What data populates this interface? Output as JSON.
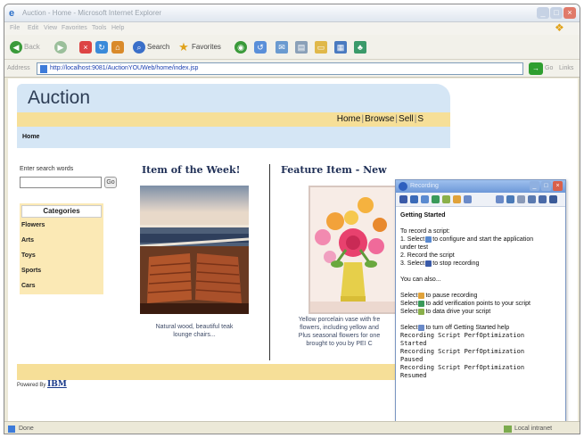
{
  "window": {
    "title": "Auction - Home - Microsoft Internet Explorer"
  },
  "menu": [
    "File",
    "Edit",
    "View",
    "Favorites",
    "Tools",
    "Help"
  ],
  "toolbar": {
    "back": "Back",
    "search": "Search",
    "favorites": "Favorites"
  },
  "address": {
    "label": "Address",
    "url": "http://localhost:9081/AuctionYOUWeb/home/index.jsp",
    "go": "Go",
    "links": "Links"
  },
  "page": {
    "site_title": "Auction",
    "nav": [
      "Home",
      "Browse",
      "Sell",
      "S"
    ],
    "home_label": "Home",
    "search_label": "Enter search words",
    "search_button": "Go",
    "categories_header": "Categories",
    "categories": [
      "Flowers",
      "Arts",
      "Toys",
      "Sports",
      "Cars"
    ],
    "item_of_week_title": "Item of the Week!",
    "item_of_week_caption_1": "Natural wood, beautiful teak",
    "item_of_week_caption_2": "lounge chairs...",
    "feature_title": "Feature Item - New",
    "feature_caption_1": "Yellow porcelain vase with fre",
    "feature_caption_2": "flowers, including yellow and",
    "feature_caption_3": "Plus seasonal flowers for one",
    "feature_caption_4": "brought to you by PEI C",
    "powered_by": "Powered By",
    "ibm": "IBM"
  },
  "status": {
    "done": "Done",
    "zone": "Local intranet"
  },
  "recorder": {
    "title": "Recording",
    "heading": "Getting Started",
    "intro": "To record a script:",
    "step1a": "1. Select",
    "step1b": "to configure and start the application",
    "step1c": "under test",
    "step2": "2. Record the script",
    "step3a": "3. Select",
    "step3b": "to stop recording",
    "also": "You can also...",
    "pause_a": "Select",
    "pause_b": "to pause recording",
    "vp_a": "Select",
    "vp_b": "to add verification points to your script",
    "dd_a": "Select",
    "dd_b": "to data drive your script",
    "off_a": "Select",
    "off_b": "to turn off Getting Started help",
    "log": [
      "Recording Script PerfOptimization",
      "Started",
      "Recording Script PerfOptimization",
      "Paused",
      "Recording Script PerfOptimization",
      "Resumed"
    ]
  }
}
